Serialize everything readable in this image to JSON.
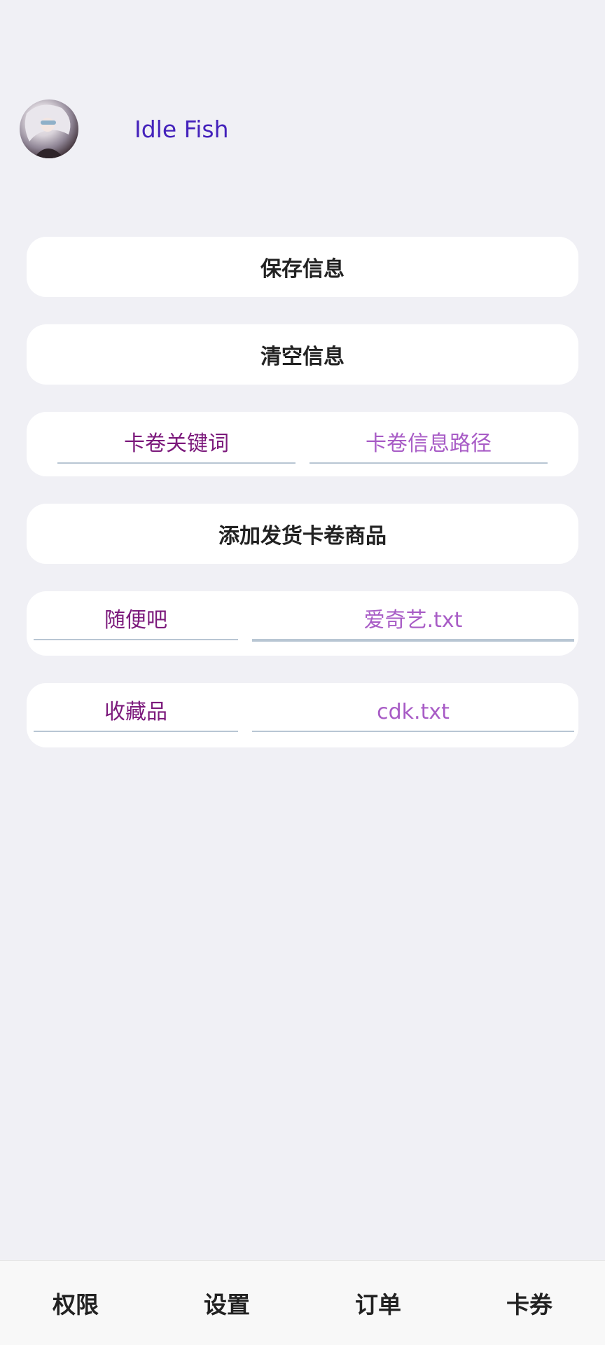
{
  "header": {
    "app_name": "Idle Fish",
    "avatar_icon": "avatar-image"
  },
  "actions": {
    "save_label": "保存信息",
    "clear_label": "清空信息",
    "add_label": "添加发货卡卷商品"
  },
  "headers_row": {
    "keyword_header": "卡卷关键词",
    "path_header": "卡卷信息路径"
  },
  "entries": [
    {
      "keyword": "随便吧",
      "path": "爱奇艺.txt"
    },
    {
      "keyword": "收藏品",
      "path": "cdk.txt"
    }
  ],
  "tabs": [
    {
      "label": "权限"
    },
    {
      "label": "设置"
    },
    {
      "label": "订单"
    },
    {
      "label": "卡券"
    }
  ],
  "colors": {
    "brand": "#4422bb",
    "keyword_text": "#7c1a7c",
    "path_text": "#a85cc6"
  }
}
